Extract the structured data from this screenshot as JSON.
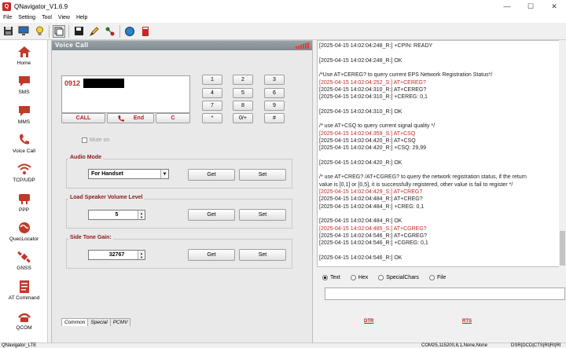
{
  "window": {
    "title": "QNavigator_V1.6.9",
    "controls": [
      "—",
      "☐",
      "✕"
    ]
  },
  "menu": {
    "items": [
      "File",
      "Setting",
      "Tool",
      "View",
      "Help"
    ]
  },
  "toolbar": {
    "icons": [
      "save-icon",
      "monitor-icon",
      "lightbulb-icon",
      "copy-icon",
      "disk-icon",
      "pencil-icon",
      "network-icon",
      "globe-icon",
      "book-icon"
    ]
  },
  "sidebar": {
    "items": [
      {
        "label": "Home",
        "icon": "home-icon"
      },
      {
        "label": "SMS",
        "icon": "sms-icon"
      },
      {
        "label": "MMS",
        "icon": "mms-icon"
      },
      {
        "label": "Voice Call",
        "icon": "phone-icon"
      },
      {
        "label": "TCP/UDP",
        "icon": "wifi-icon"
      },
      {
        "label": "PPP",
        "icon": "ppp-icon"
      },
      {
        "label": "QuecLocator",
        "icon": "locator-icon"
      },
      {
        "label": "GNSS",
        "icon": "satellite-icon"
      },
      {
        "label": "AT Command",
        "icon": "at-command-icon"
      },
      {
        "label": "QCOM",
        "icon": "qcom-icon"
      }
    ]
  },
  "voice_call": {
    "header": "Voice Call",
    "dial_number": "0912",
    "call_label": "CALL",
    "end_label": "End",
    "clear_label": "C",
    "keypad": [
      "1",
      "2",
      "3",
      "4",
      "5",
      "6",
      "7",
      "8",
      "9",
      "*",
      "0/+",
      "#"
    ],
    "mute_label": "Mute on",
    "audio_mode": {
      "title": "Audio Mode",
      "value": "For Handset",
      "get": "Get",
      "set": "Set"
    },
    "speaker_volume": {
      "title": "Load Speaker Volume Level",
      "value": "5",
      "get": "Get",
      "set": "Set"
    },
    "side_tone": {
      "title": "Side Tone Gain:",
      "value": "32767",
      "get": "Get",
      "set": "Set"
    },
    "tabs": [
      "Common",
      "Special",
      "PCMV"
    ]
  },
  "log": {
    "lines": [
      {
        "text": "[2025-04-15 14:02:04:248_R:] +CPIN: READY",
        "color": "#222222"
      },
      {
        "text": "",
        "color": "#222222"
      },
      {
        "text": "[2025-04-15 14:02:04:248_R:] OK",
        "color": "#222222"
      },
      {
        "text": "",
        "color": "#222222"
      },
      {
        "text": "/*Use AT+CEREG? to query current EPS Network Registration Status*/",
        "color": "#222222"
      },
      {
        "text": "[2025-04-15 14:02:04:252_S:] AT+CEREG?",
        "color": "#c62828"
      },
      {
        "text": "[2025-04-15 14:02:04:310_R:] AT+CEREG?",
        "color": "#222222"
      },
      {
        "text": "[2025-04-15 14:02:04:310_R:] +CEREG: 0,1",
        "color": "#222222"
      },
      {
        "text": "",
        "color": "#222222"
      },
      {
        "text": "[2025-04-15 14:02:04:310_R:] OK",
        "color": "#222222"
      },
      {
        "text": "",
        "color": "#222222"
      },
      {
        "text": "/* use AT+CSQ to query current signal quality */",
        "color": "#222222"
      },
      {
        "text": "[2025-04-15 14:02:04:359_S:] AT+CSQ",
        "color": "#c62828"
      },
      {
        "text": "[2025-04-15 14:02:04:420_R:] AT+CSQ",
        "color": "#222222"
      },
      {
        "text": "[2025-04-15 14:02:04:420_R:] +CSQ: 29,99",
        "color": "#222222"
      },
      {
        "text": "",
        "color": "#222222"
      },
      {
        "text": "[2025-04-15 14:02:04:420_R:] OK",
        "color": "#222222"
      },
      {
        "text": "",
        "color": "#222222"
      },
      {
        "text": "/* use AT+CREG? /AT+CGREG? to query the network registration status, if the return",
        "color": "#222222"
      },
      {
        "text": "value is [0,1] or [0,5], it is successfully registered, other value is fail to register */",
        "color": "#222222"
      },
      {
        "text": "[2025-04-15 14:02:04:429_S:] AT+CREG?",
        "color": "#c62828"
      },
      {
        "text": "[2025-04-15 14:02:04:484_R:] AT+CREG?",
        "color": "#222222"
      },
      {
        "text": "[2025-04-15 14:02:04:484_R:] +CREG: 0,1",
        "color": "#222222"
      },
      {
        "text": "",
        "color": "#222222"
      },
      {
        "text": "[2025-04-15 14:02:04:484_R:] OK",
        "color": "#222222"
      },
      {
        "text": "[2025-04-15 14:02:04:485_S:] AT+CGREG?",
        "color": "#c62828"
      },
      {
        "text": "[2025-04-15 14:02:04:546_R:] AT+CGREG?",
        "color": "#222222"
      },
      {
        "text": "[2025-04-15 14:02:04:546_R:] +CGREG: 0,1",
        "color": "#222222"
      },
      {
        "text": "",
        "color": "#222222"
      },
      {
        "text": "[2025-04-15 14:02:04:546_R:] OK",
        "color": "#222222"
      }
    ]
  },
  "send_options": {
    "selected": "Text",
    "options": [
      "Text",
      "Hex",
      "SpecialChars",
      "File"
    ]
  },
  "line_controls": {
    "dtr": "DTR",
    "rts": "RTS"
  },
  "status": {
    "left": "QNavigator_LTE",
    "port": "COM25,115200,8,1,None,None",
    "signals": "DSR|DCD|CTS|RI|RI|RI"
  },
  "colors": {
    "accent_red": "#c62828",
    "header_gray": "#8a9498"
  }
}
